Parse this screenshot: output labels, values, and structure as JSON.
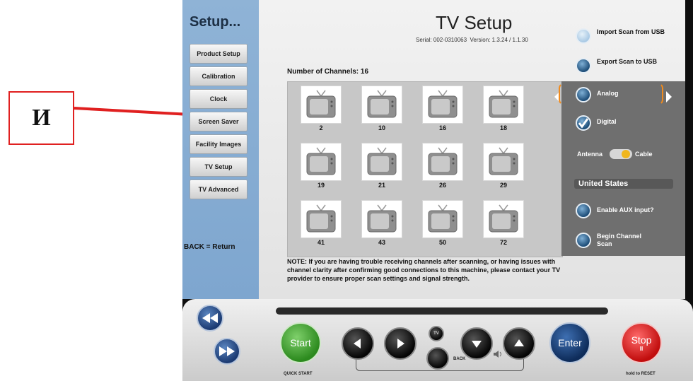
{
  "annotation": {
    "letter": "И"
  },
  "sidebar": {
    "title": "Setup...",
    "items": [
      {
        "label": "Product Setup"
      },
      {
        "label": "Calibration"
      },
      {
        "label": "Clock"
      },
      {
        "label": "Screen Saver"
      },
      {
        "label": "Facility Images"
      },
      {
        "label": "TV Setup"
      },
      {
        "label": "TV Advanced"
      }
    ],
    "back_label": "BACK",
    "back_symbol": "=",
    "back_target": "Return"
  },
  "header": {
    "title": "TV Setup",
    "serial": "Serial: 002-0310063",
    "version": "Version: 1.3.24 / 1.1.30"
  },
  "channels": {
    "label": "Number of Channels: 16",
    "list": [
      "2",
      "10",
      "16",
      "18",
      "19",
      "21",
      "26",
      "29",
      "41",
      "43",
      "50",
      "72"
    ]
  },
  "options": {
    "import_scan": "Import Scan from USB",
    "export_scan": "Export Scan to USB",
    "analog": "Analog",
    "digital": "Digital",
    "antenna": "Antenna",
    "cable": "Cable",
    "region": "United States",
    "enable_aux": "Enable AUX input?",
    "begin_scan": "Begin Channel Scan"
  },
  "note": "NOTE: If you are having trouble receiving channels after scanning, or having issues with channel clarity after confirming good connections to this machine, please contact your TV provider to ensure proper scan settings and signal strength.",
  "controls": {
    "start": "Start",
    "quick_start": "QUICK START",
    "enter": "Enter",
    "stop": "Stop",
    "stop_sub": "II",
    "hold_reset": "hold to RESET",
    "back": "BACK",
    "tv_icon_label": "TV"
  },
  "colors": {
    "sidebar_blue": "#7ea6cf",
    "highlight_orange": "#f08a1c",
    "start_green": "#2c8a1e",
    "stop_red": "#c10d0d",
    "enter_blue": "#0e2c5a"
  }
}
